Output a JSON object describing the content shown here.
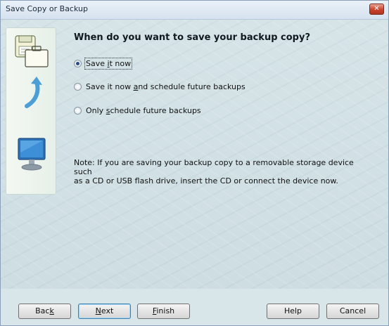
{
  "window": {
    "title": "Save Copy or Backup"
  },
  "wizard": {
    "heading": "When do you want to save your backup copy?",
    "options": [
      {
        "pre": "Save ",
        "key": "i",
        "post": "t now",
        "checked": true
      },
      {
        "pre": "Save it now ",
        "key": "a",
        "post": "nd schedule future backups",
        "checked": false
      },
      {
        "pre": "Only ",
        "key": "s",
        "post": "chedule future backups",
        "checked": false
      }
    ],
    "note_line1": "Note: If you are saving your backup copy to a removable storage device such",
    "note_line2": "as a CD or USB flash drive, insert the CD or connect the device now."
  },
  "buttons": {
    "back": {
      "pre": "Bac",
      "key": "k",
      "post": ""
    },
    "next": {
      "pre": "",
      "key": "N",
      "post": "ext"
    },
    "finish": {
      "pre": "",
      "key": "F",
      "post": "inish"
    },
    "help": "Help",
    "cancel": "Cancel"
  },
  "icons": [
    "floppy-disk-icon",
    "briefcase-icon",
    "arrow-icon",
    "monitor-icon",
    "close-icon"
  ]
}
